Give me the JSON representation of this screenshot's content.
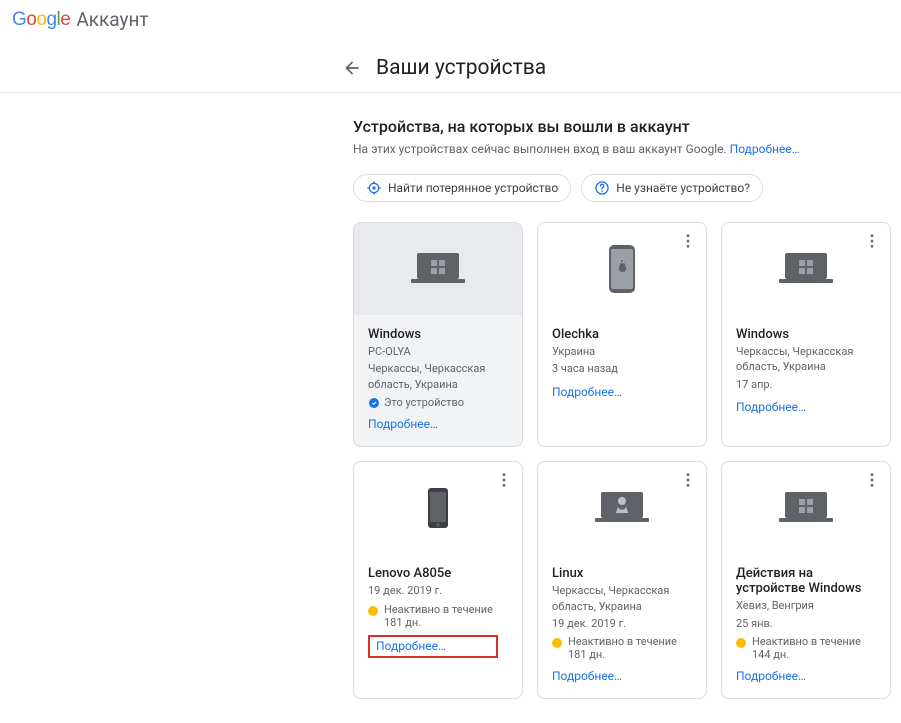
{
  "brand": {
    "product_label": "Аккаунт"
  },
  "page": {
    "title": "Ваши устройства",
    "section_title": "Устройства, на которых вы вошли в аккаунт",
    "section_desc": "На этих устройствах сейчас выполнен вход в ваш аккаунт Google.",
    "section_more": "Подробнее…"
  },
  "chips": {
    "find": "Найти потерянное устройство",
    "unrecognized": "Не узнаёте устройство?"
  },
  "labels": {
    "this_device": "Это устройство",
    "more": "Подробнее…"
  },
  "devices": [
    {
      "name": "Windows",
      "subtitle1": "PC-OLYA",
      "subtitle2": "Черкассы, Черкасская область, Украина",
      "activity": "",
      "inactive": "",
      "this_device": true,
      "icon": "windows-laptop",
      "current": true
    },
    {
      "name": "Olechka",
      "subtitle1": "",
      "subtitle2": "Украина",
      "activity": "3 часа назад",
      "inactive": "",
      "this_device": false,
      "icon": "iphone",
      "current": false
    },
    {
      "name": "Windows",
      "subtitle1": "",
      "subtitle2": "Черкассы, Черкасская область, Украина",
      "activity": "17 апр.",
      "inactive": "",
      "this_device": false,
      "icon": "windows-laptop",
      "current": false
    },
    {
      "name": "Lenovo A805e",
      "subtitle1": "",
      "subtitle2": "",
      "activity": "19 дек. 2019 г.",
      "inactive": "Неактивно в течение 181 дн.",
      "this_device": false,
      "icon": "android-phone",
      "current": false,
      "highlight_more": true
    },
    {
      "name": "Linux",
      "subtitle1": "",
      "subtitle2": "Черкассы, Черкасская область, Украина",
      "activity": "19 дек. 2019 г.",
      "inactive": "Неактивно в течение 181 дн.",
      "this_device": false,
      "icon": "linux-laptop",
      "current": false
    },
    {
      "name": "Действия на устройстве Windows",
      "subtitle1": "",
      "subtitle2": "Хевиз, Венгрия",
      "activity": "25 янв.",
      "inactive": "Неактивно в течение 144 дн.",
      "this_device": false,
      "icon": "windows-laptop",
      "current": false
    }
  ]
}
